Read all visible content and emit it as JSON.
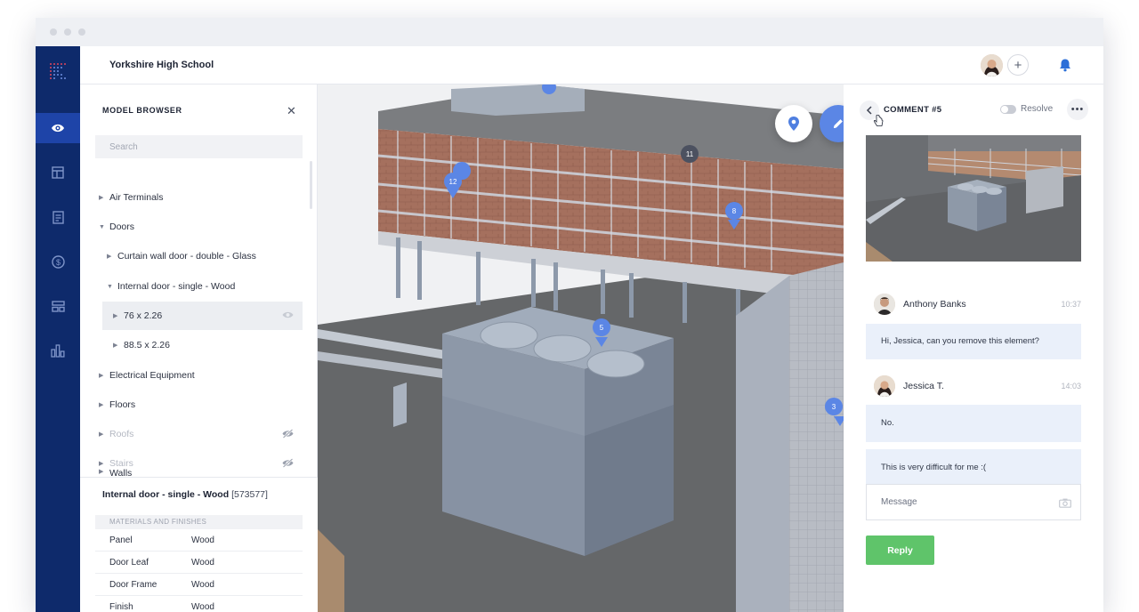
{
  "app": {
    "project_title": "Yorkshire High School"
  },
  "colors": {
    "rail": "#0e2a6b",
    "rail_active": "#1e44a8",
    "accent": "#5b86e5",
    "reply": "#5fc46a"
  },
  "rail": {
    "items": [
      {
        "icon": "eye-icon",
        "active": true
      },
      {
        "icon": "layout-icon",
        "active": false
      },
      {
        "icon": "document-icon",
        "active": false
      },
      {
        "icon": "dollar-icon",
        "active": false
      },
      {
        "icon": "dashboard-icon",
        "active": false
      },
      {
        "icon": "bar-chart-icon",
        "active": false
      }
    ]
  },
  "model_browser": {
    "title": "MODEL BROWSER",
    "search_placeholder": "Search",
    "items": [
      {
        "label": "Air Terminals"
      },
      {
        "label": "Doors"
      },
      {
        "label": "Curtain wall door - double - Glass"
      },
      {
        "label": "Internal door - single - Wood"
      },
      {
        "label": "76 x 2.26"
      },
      {
        "label": "88.5 x 2.26"
      },
      {
        "label": "Electrical Equipment"
      },
      {
        "label": "Floors"
      },
      {
        "label": "Roofs"
      },
      {
        "label": "Stairs"
      },
      {
        "label": "Walls"
      }
    ]
  },
  "properties": {
    "element_name": "Internal door - single - Wood",
    "element_id": "[573577]",
    "section": "MATERIALS AND FINISHES",
    "rows": [
      {
        "key": "Panel",
        "value": "Wood"
      },
      {
        "key": "Door Leaf",
        "value": "Wood"
      },
      {
        "key": "Door Frame",
        "value": "Wood"
      },
      {
        "key": "Finish",
        "value": "Wood"
      }
    ]
  },
  "viewport": {
    "pins": [
      {
        "label": "12"
      },
      {
        "label": "8"
      },
      {
        "label": "5"
      },
      {
        "label": "3"
      }
    ],
    "markers": [
      {
        "label": "11"
      }
    ]
  },
  "comment": {
    "title": "COMMENT #5",
    "resolve_label": "Resolve",
    "entries": [
      {
        "author": "Anthony Banks",
        "time": "10:37",
        "messages": [
          "Hi, Jessica, can you remove this element?"
        ]
      },
      {
        "author": "Jessica T.",
        "time": "14:03",
        "messages": [
          "No.",
          "This is very difficult for me :("
        ]
      }
    ],
    "message_placeholder": "Message",
    "reply_label": "Reply"
  }
}
